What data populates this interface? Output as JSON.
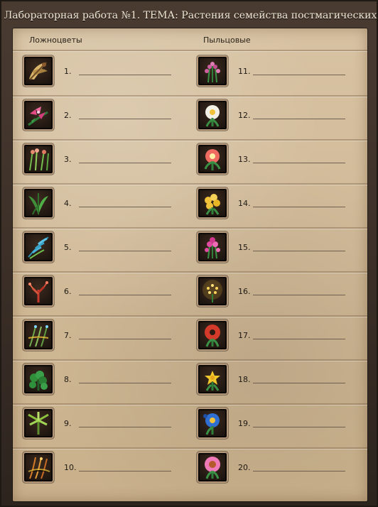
{
  "window": {
    "title": "Лабораторная работа №1. ТЕМА: Растения семейства постмагических"
  },
  "columns": {
    "left_header": "Ложноцветы",
    "right_header": "Пыльцовые"
  },
  "items_left": [
    {
      "number": "1.",
      "icon": "dried-leaf-plant-icon",
      "accent": "#d9b56b"
    },
    {
      "number": "2.",
      "icon": "pink-lily-plant-icon",
      "accent": "#e44a86"
    },
    {
      "number": "3.",
      "icon": "tall-grass-plant-icon",
      "accent": "#e78b6e"
    },
    {
      "number": "4.",
      "icon": "broad-leaf-plant-icon",
      "accent": "#3f8f3b"
    },
    {
      "number": "5.",
      "icon": "blue-fern-plant-icon",
      "accent": "#3aa0c5"
    },
    {
      "number": "6.",
      "icon": "red-coral-plant-icon",
      "accent": "#c63a2e"
    },
    {
      "number": "7.",
      "icon": "glowing-grass-plant-icon",
      "accent": "#6fa84a"
    },
    {
      "number": "8.",
      "icon": "clover-plant-icon",
      "accent": "#2f8f3a"
    },
    {
      "number": "9.",
      "icon": "spiky-palm-plant-icon",
      "accent": "#8cc23d"
    },
    {
      "number": "10.",
      "icon": "autumn-reeds-plant-icon",
      "accent": "#d27a2a"
    }
  ],
  "items_right": [
    {
      "number": "11.",
      "icon": "pink-buds-plant-icon",
      "accent": "#d05fa1"
    },
    {
      "number": "12.",
      "icon": "daisy-plant-icon",
      "accent": "#f3f0e6"
    },
    {
      "number": "13.",
      "icon": "coral-bloom-plant-icon",
      "accent": "#ef6b62"
    },
    {
      "number": "14.",
      "icon": "yellow-clusters-plant-icon",
      "accent": "#f2c33a"
    },
    {
      "number": "15.",
      "icon": "magenta-flowers-plant-icon",
      "accent": "#e14aa2"
    },
    {
      "number": "16.",
      "icon": "glowing-pollen-plant-icon",
      "accent": "#f6c23a"
    },
    {
      "number": "17.",
      "icon": "poppy-plant-icon",
      "accent": "#d43a2a"
    },
    {
      "number": "18.",
      "icon": "yellow-star-flowers-plant-icon",
      "accent": "#f2c92c"
    },
    {
      "number": "19.",
      "icon": "cornflower-plant-icon",
      "accent": "#2e6fd1"
    },
    {
      "number": "20.",
      "icon": "pink-echinacea-plant-icon",
      "accent": "#f07ab7"
    }
  ]
}
